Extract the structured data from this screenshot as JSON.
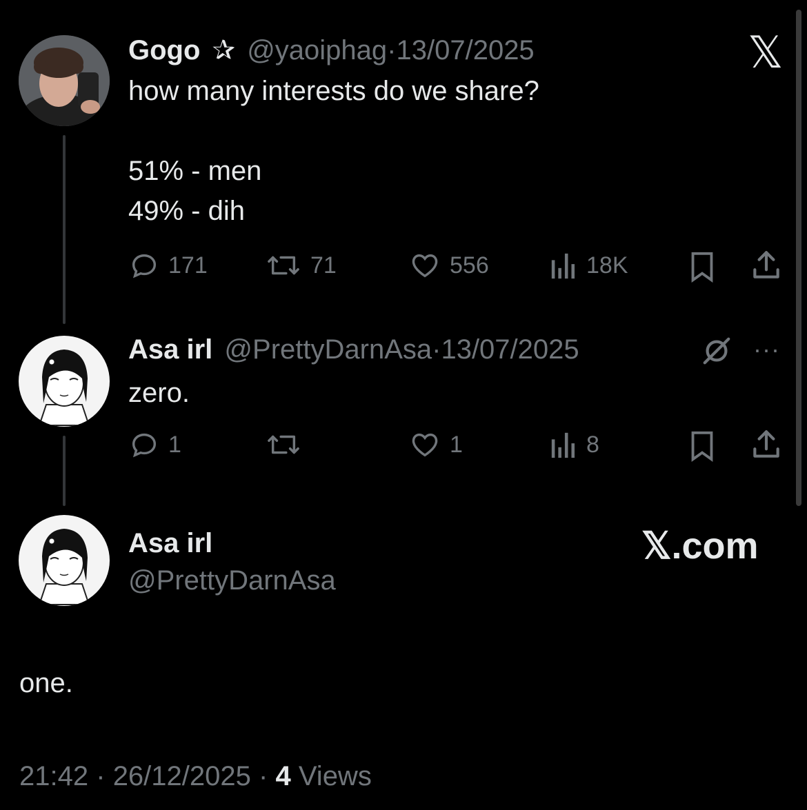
{
  "tweet1": {
    "name": "Gogo",
    "badge": "✰",
    "handle": "@yaoiphag",
    "sep": "·",
    "date": "13/07/2025",
    "lines": [
      "how many interests do we share?",
      "51% - men",
      "49% - dih"
    ],
    "replies": "171",
    "retweets": "71",
    "likes": "556",
    "views": "18K"
  },
  "tweet2": {
    "name": "Asa irl",
    "handle": "@PrettyDarnAsa",
    "sep": "·",
    "date": "13/07/2025",
    "text": "zero.",
    "replies": "1",
    "likes": "1",
    "views": "8"
  },
  "main": {
    "name": "Asa irl",
    "handle": "@PrettyDarnAsa",
    "watermark": "𝕏.com",
    "text": "one.",
    "time": "21:42",
    "sep1": "·",
    "date": "26/12/2025",
    "sep2": "·",
    "views_count": "4",
    "views_label": "Views"
  },
  "icons": {
    "x_logo": "𝕏",
    "more": "···"
  }
}
